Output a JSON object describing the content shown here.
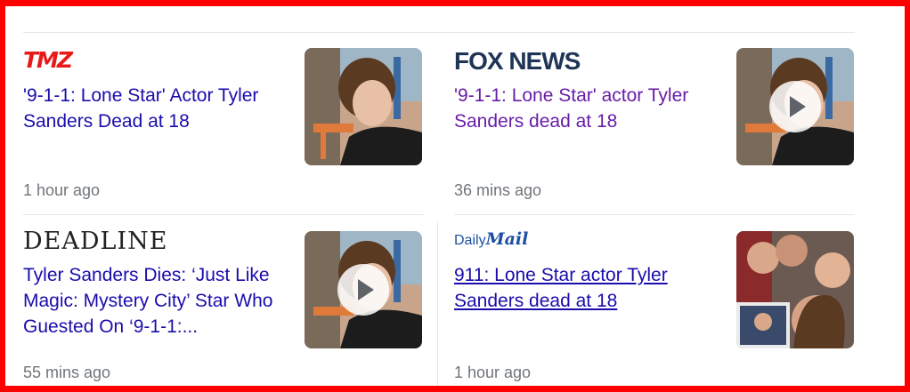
{
  "articles": [
    {
      "source": "TMZ",
      "title": "'9-1-1: Lone Star' Actor Tyler Sanders Dead at 18",
      "time": "1 hour ago",
      "thumbnail_icon": "portrait-photo",
      "has_video": false
    },
    {
      "source": "FOX NEWS",
      "title": "'9-1-1: Lone Star' actor Tyler Sanders dead at 18",
      "time": "36 mins ago",
      "thumbnail_icon": "portrait-photo",
      "has_video": true
    },
    {
      "source": "DEADLINE",
      "title": "Tyler Sanders Dies: ‘Just Like Magic: Mystery City’ Star Who Guested On ‘9-1-1:...",
      "time": "55 mins ago",
      "thumbnail_icon": "portrait-photo",
      "has_video": true
    },
    {
      "source_prefix": "Daily",
      "source": "Mail",
      "title": "911: Lone Star actor Tyler Sanders dead at 18",
      "time": "1 hour ago",
      "thumbnail_icon": "group-photo",
      "has_video": false
    }
  ],
  "colors": {
    "link": "#1a0dab",
    "visited": "#681da8",
    "meta": "#70757a",
    "frame": "#ff0000"
  }
}
